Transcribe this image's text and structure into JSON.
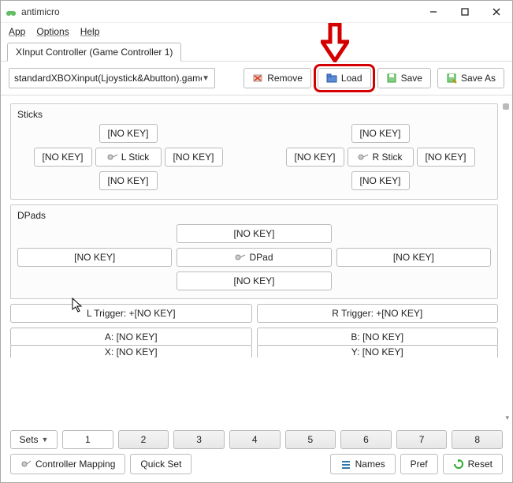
{
  "window": {
    "title": "antimicro"
  },
  "menu": {
    "app": "App",
    "options": "Options",
    "help": "Help"
  },
  "tab": {
    "label": "XInput Controller (Game Controller 1)"
  },
  "toolbar": {
    "profile": "standardXBOXinput(Ljoystick&Abutton).gamec",
    "remove": "Remove",
    "load": "Load",
    "save": "Save",
    "save_as": "Save As"
  },
  "sticks": {
    "title": "Sticks",
    "left": {
      "up": "[NO KEY]",
      "left": "[NO KEY]",
      "center": "L Stick",
      "right": "[NO KEY]",
      "down": "[NO KEY]"
    },
    "right": {
      "up": "[NO KEY]",
      "left": "[NO KEY]",
      "center": "R Stick",
      "right": "[NO KEY]",
      "down": "[NO KEY]"
    }
  },
  "dpads": {
    "title": "DPads",
    "up": "[NO KEY]",
    "left": "[NO KEY]",
    "center": "DPad",
    "right": "[NO KEY]",
    "down": "[NO KEY]"
  },
  "triggers": {
    "l": "L Trigger: +[NO KEY]",
    "r": "R Trigger: +[NO KEY]"
  },
  "buttons": {
    "a": "A: [NO KEY]",
    "b": "B: [NO KEY]",
    "x": "X: [NO KEY]",
    "y": "Y: [NO KEY]"
  },
  "sets": {
    "label": "Sets",
    "items": [
      "1",
      "2",
      "3",
      "4",
      "5",
      "6",
      "7",
      "8"
    ]
  },
  "bottom": {
    "ctrlmap": "Controller Mapping",
    "quickset": "Quick Set",
    "names": "Names",
    "pref": "Pref",
    "reset": "Reset"
  }
}
